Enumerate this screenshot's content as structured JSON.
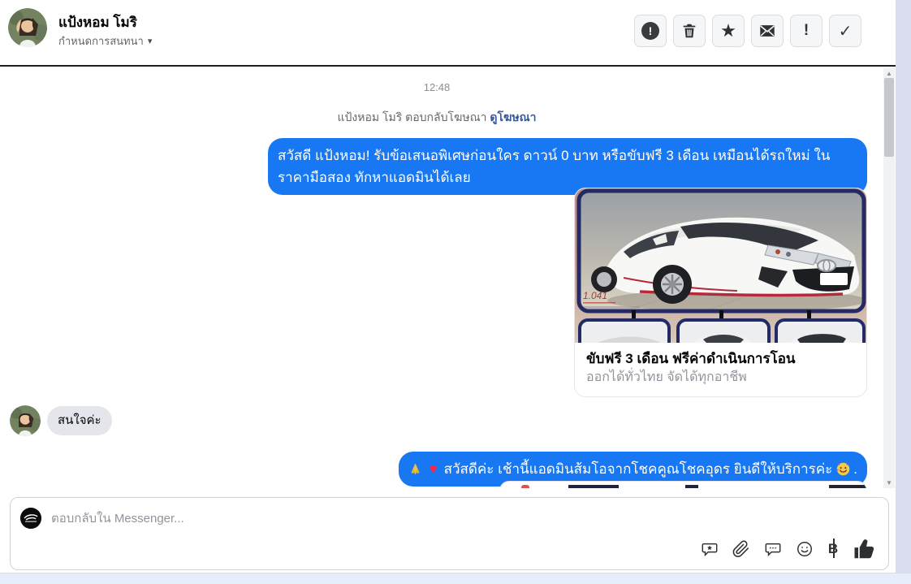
{
  "header": {
    "name": "แป้งหอม โมริ",
    "subtitle": "กำหนดการสนทนา",
    "toolbar": {
      "report_label": "!",
      "exclamation_label": "!"
    }
  },
  "chat": {
    "timestamp": "12:48",
    "system_text": "แป้งหอม โมริ ตอบกลับโฆษณา",
    "system_link": "ดูโฆษณา",
    "outgoing1": "สวัสดี แป้งหอม! รับข้อเสนอพิเศษก่อนใคร ดาวน์ 0 บาท หรือขับฟรี 3 เดือน เหมือนได้รถใหม่ ในราคามือสอง ทักหาแอดมินได้เลย",
    "card": {
      "title": "ขับฟรี 3 เดือน ฟรีค่าดำเนินการโอน",
      "subtitle": "ออกได้ทั่วไทย จัดได้ทุกอาชีพ",
      "watermark": "1.041"
    },
    "incoming1": "สนใจค่ะ",
    "outgoing2": {
      "leading_emojis": [
        "folded-hands",
        "red-heart"
      ],
      "text": "สวัสดีค่ะ เช้านี้แอดมินส้มโอจากโชคคูณโชคอุดร ยินดีให้บริการค่ะ",
      "trailing_emoji": "smiling-face-with-hearts",
      "trailing_text": "."
    }
  },
  "composer": {
    "placeholder": "ตอบกลับใน Messenger..."
  },
  "icons": {
    "caret_down": "▾",
    "star": "★",
    "check": "✓",
    "heart": "♥",
    "baht_letter": "B",
    "scroll_up": "▲",
    "scroll_down": "▼"
  },
  "colors": {
    "bubble_blue": "#1877f2",
    "link_blue": "#385898",
    "incoming_gray": "#e4e6eb",
    "header_border": "#1c1e21"
  }
}
